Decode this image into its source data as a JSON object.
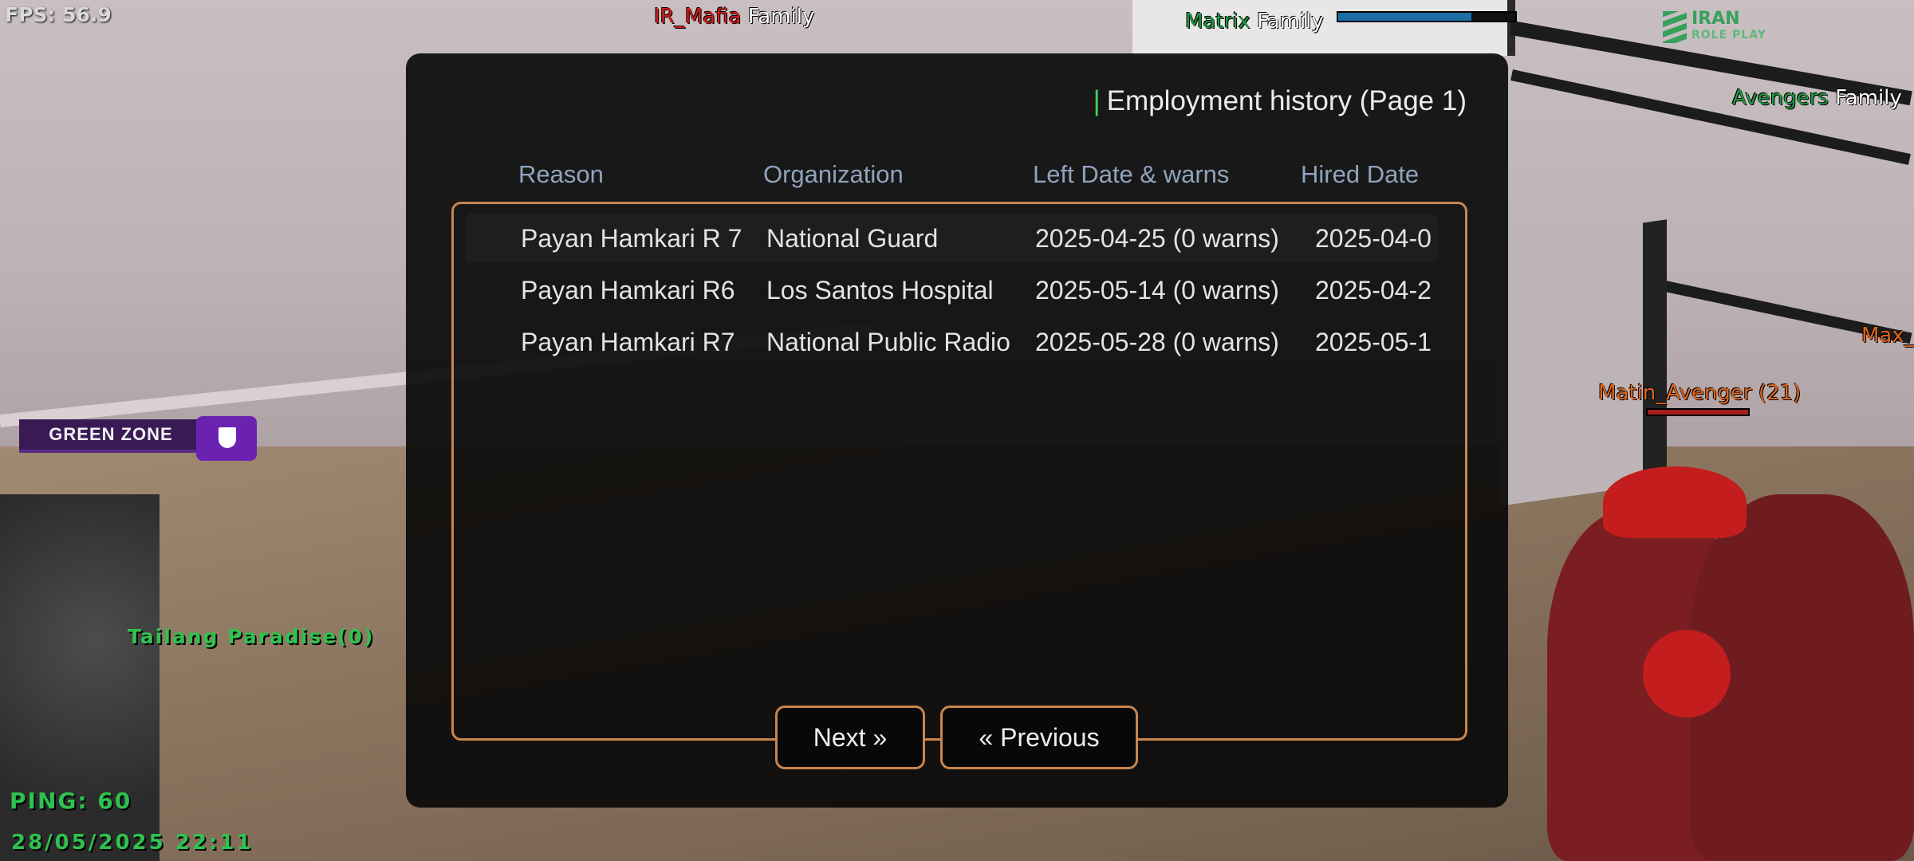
{
  "hud": {
    "fps": "FPS: 56.9",
    "ping": "PING: 60",
    "datetime": "28/05/2025 22:11",
    "zone_label": "GREEN ZONE",
    "brand": "IRAN",
    "brand_sub": "ROLE PLAY",
    "location_label": "Tailang Paradise(0)",
    "icons": [
      "shield-icon"
    ]
  },
  "world_tags": [
    {
      "gang": "IR_Mafia",
      "suffix": "Family",
      "color": "#d11d1d"
    },
    {
      "gang": "Matrix",
      "suffix": "Family",
      "color": "#1f9a42"
    },
    {
      "gang": "Avengers",
      "suffix": "Family",
      "color": "#1f9a42"
    },
    {
      "name": "Matin_Avenger (21)",
      "color": "#e0661e"
    },
    {
      "name": "Max_",
      "color": "#e0661e"
    }
  ],
  "health": {
    "matrix_bar": 0.75,
    "matin_bar": 1.0
  },
  "dialog": {
    "title": "Employment history (Page 1)",
    "columns": [
      "Reason",
      "Organization",
      "Left Date & warns",
      "Hired Date"
    ],
    "rows": [
      {
        "reason": "Payan Hamkari R 7",
        "organization": "National Guard",
        "left": "2025-04-25 (0 warns)",
        "hired": "2025-04-0"
      },
      {
        "reason": "Payan Hamkari R6",
        "organization": "Los Santos Hospital",
        "left": "2025-05-14 (0 warns)",
        "hired": "2025-04-2"
      },
      {
        "reason": "Payan Hamkari R7",
        "organization": "National Public Radio",
        "left": "2025-05-28 (0 warns)",
        "hired": "2025-05-1"
      }
    ],
    "next_label": "Next »",
    "prev_label": "« Previous",
    "colors": {
      "accent": "#3fd15b",
      "border": "#c9864d",
      "header": "#8fa4bd"
    }
  }
}
